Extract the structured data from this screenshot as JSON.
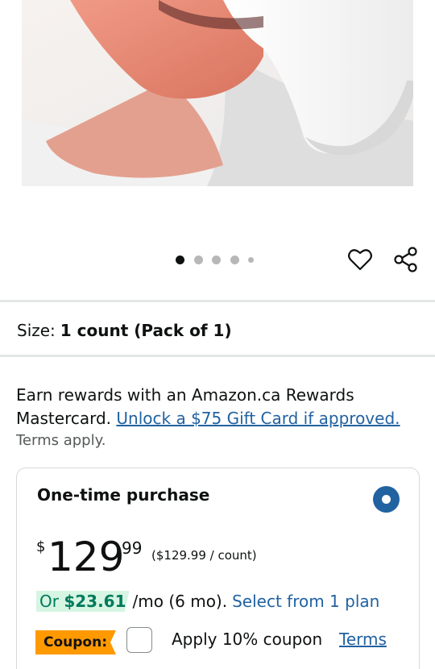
{
  "product_image": {
    "alt": "woman wearing red light therapy face mask"
  },
  "carousel": {
    "total": 5,
    "active_index": 0
  },
  "actions": {
    "wishlist_icon": "heart-outline-icon",
    "share_icon": "share-icon"
  },
  "size": {
    "label": "Size:",
    "value": "1 count (Pack of 1)"
  },
  "rewards": {
    "text": "Earn rewards with an Amazon.ca Rewards Mastercard.",
    "link": "Unlock a $75 Gift Card if approved.",
    "terms": "Terms apply."
  },
  "purchase": {
    "title": "One-time purchase",
    "selected": true,
    "price_symbol": "$",
    "price_whole": "129",
    "price_fraction": "99",
    "unit_price": "($129.99 / count)",
    "monthly_prefix": "Or",
    "monthly_amount": "$23.61",
    "monthly_term": "/mo (6 mo).",
    "plan_link": "Select from 1 plan",
    "coupon_badge": "Coupon:",
    "coupon_checked": false,
    "coupon_text": "Apply 10% coupon",
    "coupon_terms": "Terms"
  },
  "colors": {
    "link": "#2162a1",
    "coupon_badge": "#ff9900",
    "monthly_badge_bg": "#d6f5e3",
    "monthly_badge_text": "#007a5c",
    "radio_selected": "#2162a1"
  }
}
